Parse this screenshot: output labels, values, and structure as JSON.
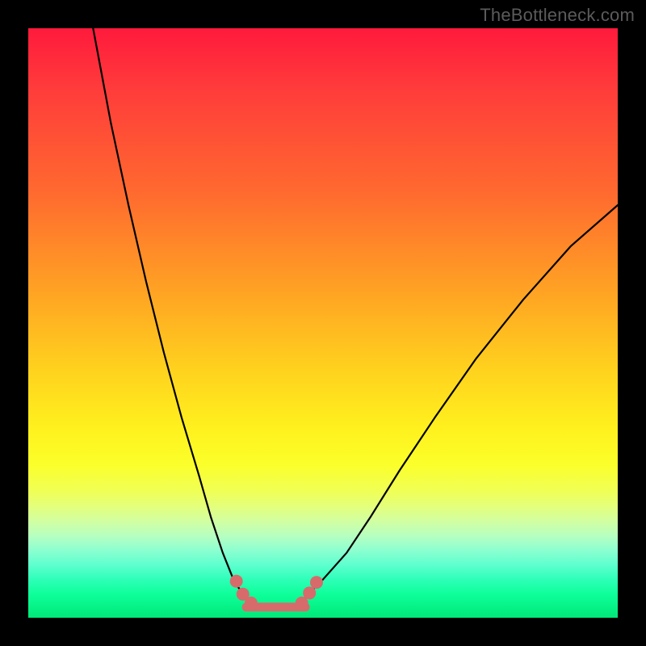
{
  "watermark": "TheBottleneck.com",
  "chart_data": {
    "type": "line",
    "title": "",
    "xlabel": "",
    "ylabel": "",
    "xlim": [
      0,
      100
    ],
    "ylim": [
      0,
      100
    ],
    "grid": false,
    "legend": false,
    "series": [
      {
        "name": "left-branch",
        "x": [
          11,
          14,
          17,
          20,
          23,
          26,
          29,
          31,
          33,
          35,
          36.5
        ],
        "y": [
          100,
          84,
          70,
          57,
          45,
          34,
          24,
          17,
          11,
          6,
          4
        ]
      },
      {
        "name": "valley-floor",
        "x": [
          36.5,
          38,
          40,
          42,
          44,
          46,
          47.5
        ],
        "y": [
          4,
          2.3,
          1.5,
          1.4,
          1.6,
          2.3,
          4
        ]
      },
      {
        "name": "right-branch",
        "x": [
          47.5,
          50,
          54,
          58,
          63,
          69,
          76,
          84,
          92,
          100
        ],
        "y": [
          4,
          6.5,
          11,
          17,
          25,
          34,
          44,
          54,
          63,
          70
        ]
      }
    ],
    "markers": {
      "name": "valley-dots",
      "color": "#d76b6b",
      "points": [
        {
          "x": 35.3,
          "y": 6.2
        },
        {
          "x": 36.4,
          "y": 4.0
        },
        {
          "x": 37.8,
          "y": 2.5
        },
        {
          "x": 46.4,
          "y": 2.5
        },
        {
          "x": 47.7,
          "y": 4.2
        },
        {
          "x": 48.9,
          "y": 6.0
        }
      ]
    },
    "valley_band": {
      "color": "#d76b6b",
      "x_range": [
        37.0,
        47.0
      ],
      "y": 1.8,
      "thickness_pct": 1.5
    }
  }
}
